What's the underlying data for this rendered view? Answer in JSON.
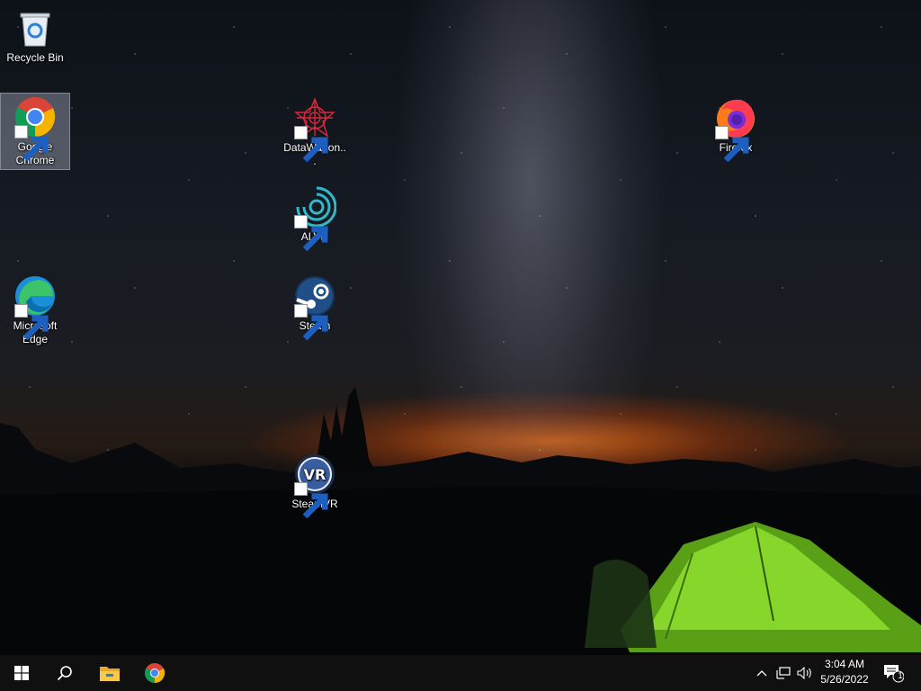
{
  "desktop": {
    "icons": [
      {
        "id": "recycle-bin",
        "label": "Recycle Bin"
      },
      {
        "id": "google-chrome",
        "label": "Google Chrome",
        "selected": true
      },
      {
        "id": "microsoft-edge",
        "label": "Microsoft Edge"
      },
      {
        "id": "datawagon",
        "label": "DataWagon..."
      },
      {
        "id": "alvr",
        "label": "ALVR"
      },
      {
        "id": "steam",
        "label": "Steam"
      },
      {
        "id": "steamvr",
        "label": "SteamVR"
      },
      {
        "id": "firefox",
        "label": "Firefox"
      }
    ]
  },
  "taskbar": {
    "start_icon": "windows-logo-icon",
    "search_icon": "search-icon",
    "pinned": [
      "file-explorer-icon",
      "chrome-icon"
    ],
    "tray": {
      "icons": [
        "chevron-up-icon",
        "network-icon",
        "volume-icon"
      ],
      "time": "3:04 AM",
      "date": "5/26/2022",
      "notification_count": "1"
    }
  },
  "colors": {
    "taskbar": "#101010",
    "accent_glow": "#e0701c",
    "tent": "#7ed321"
  }
}
